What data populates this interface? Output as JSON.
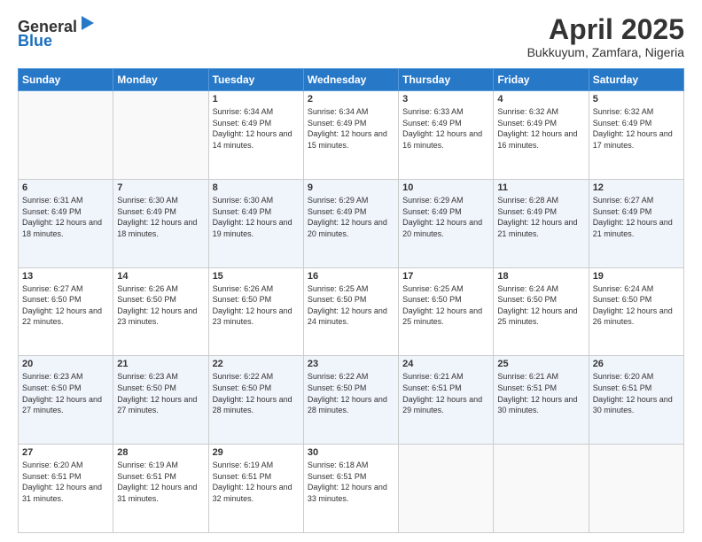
{
  "header": {
    "logo_general": "General",
    "logo_blue": "Blue",
    "month_title": "April 2025",
    "subtitle": "Bukkuyum, Zamfara, Nigeria"
  },
  "columns": [
    "Sunday",
    "Monday",
    "Tuesday",
    "Wednesday",
    "Thursday",
    "Friday",
    "Saturday"
  ],
  "weeks": [
    {
      "days": [
        {
          "num": "",
          "info": ""
        },
        {
          "num": "",
          "info": ""
        },
        {
          "num": "1",
          "info": "Sunrise: 6:34 AM\nSunset: 6:49 PM\nDaylight: 12 hours and 14 minutes."
        },
        {
          "num": "2",
          "info": "Sunrise: 6:34 AM\nSunset: 6:49 PM\nDaylight: 12 hours and 15 minutes."
        },
        {
          "num": "3",
          "info": "Sunrise: 6:33 AM\nSunset: 6:49 PM\nDaylight: 12 hours and 16 minutes."
        },
        {
          "num": "4",
          "info": "Sunrise: 6:32 AM\nSunset: 6:49 PM\nDaylight: 12 hours and 16 minutes."
        },
        {
          "num": "5",
          "info": "Sunrise: 6:32 AM\nSunset: 6:49 PM\nDaylight: 12 hours and 17 minutes."
        }
      ]
    },
    {
      "days": [
        {
          "num": "6",
          "info": "Sunrise: 6:31 AM\nSunset: 6:49 PM\nDaylight: 12 hours and 18 minutes."
        },
        {
          "num": "7",
          "info": "Sunrise: 6:30 AM\nSunset: 6:49 PM\nDaylight: 12 hours and 18 minutes."
        },
        {
          "num": "8",
          "info": "Sunrise: 6:30 AM\nSunset: 6:49 PM\nDaylight: 12 hours and 19 minutes."
        },
        {
          "num": "9",
          "info": "Sunrise: 6:29 AM\nSunset: 6:49 PM\nDaylight: 12 hours and 20 minutes."
        },
        {
          "num": "10",
          "info": "Sunrise: 6:29 AM\nSunset: 6:49 PM\nDaylight: 12 hours and 20 minutes."
        },
        {
          "num": "11",
          "info": "Sunrise: 6:28 AM\nSunset: 6:49 PM\nDaylight: 12 hours and 21 minutes."
        },
        {
          "num": "12",
          "info": "Sunrise: 6:27 AM\nSunset: 6:49 PM\nDaylight: 12 hours and 21 minutes."
        }
      ]
    },
    {
      "days": [
        {
          "num": "13",
          "info": "Sunrise: 6:27 AM\nSunset: 6:50 PM\nDaylight: 12 hours and 22 minutes."
        },
        {
          "num": "14",
          "info": "Sunrise: 6:26 AM\nSunset: 6:50 PM\nDaylight: 12 hours and 23 minutes."
        },
        {
          "num": "15",
          "info": "Sunrise: 6:26 AM\nSunset: 6:50 PM\nDaylight: 12 hours and 23 minutes."
        },
        {
          "num": "16",
          "info": "Sunrise: 6:25 AM\nSunset: 6:50 PM\nDaylight: 12 hours and 24 minutes."
        },
        {
          "num": "17",
          "info": "Sunrise: 6:25 AM\nSunset: 6:50 PM\nDaylight: 12 hours and 25 minutes."
        },
        {
          "num": "18",
          "info": "Sunrise: 6:24 AM\nSunset: 6:50 PM\nDaylight: 12 hours and 25 minutes."
        },
        {
          "num": "19",
          "info": "Sunrise: 6:24 AM\nSunset: 6:50 PM\nDaylight: 12 hours and 26 minutes."
        }
      ]
    },
    {
      "days": [
        {
          "num": "20",
          "info": "Sunrise: 6:23 AM\nSunset: 6:50 PM\nDaylight: 12 hours and 27 minutes."
        },
        {
          "num": "21",
          "info": "Sunrise: 6:23 AM\nSunset: 6:50 PM\nDaylight: 12 hours and 27 minutes."
        },
        {
          "num": "22",
          "info": "Sunrise: 6:22 AM\nSunset: 6:50 PM\nDaylight: 12 hours and 28 minutes."
        },
        {
          "num": "23",
          "info": "Sunrise: 6:22 AM\nSunset: 6:50 PM\nDaylight: 12 hours and 28 minutes."
        },
        {
          "num": "24",
          "info": "Sunrise: 6:21 AM\nSunset: 6:51 PM\nDaylight: 12 hours and 29 minutes."
        },
        {
          "num": "25",
          "info": "Sunrise: 6:21 AM\nSunset: 6:51 PM\nDaylight: 12 hours and 30 minutes."
        },
        {
          "num": "26",
          "info": "Sunrise: 6:20 AM\nSunset: 6:51 PM\nDaylight: 12 hours and 30 minutes."
        }
      ]
    },
    {
      "days": [
        {
          "num": "27",
          "info": "Sunrise: 6:20 AM\nSunset: 6:51 PM\nDaylight: 12 hours and 31 minutes."
        },
        {
          "num": "28",
          "info": "Sunrise: 6:19 AM\nSunset: 6:51 PM\nDaylight: 12 hours and 31 minutes."
        },
        {
          "num": "29",
          "info": "Sunrise: 6:19 AM\nSunset: 6:51 PM\nDaylight: 12 hours and 32 minutes."
        },
        {
          "num": "30",
          "info": "Sunrise: 6:18 AM\nSunset: 6:51 PM\nDaylight: 12 hours and 33 minutes."
        },
        {
          "num": "",
          "info": ""
        },
        {
          "num": "",
          "info": ""
        },
        {
          "num": "",
          "info": ""
        }
      ]
    }
  ]
}
